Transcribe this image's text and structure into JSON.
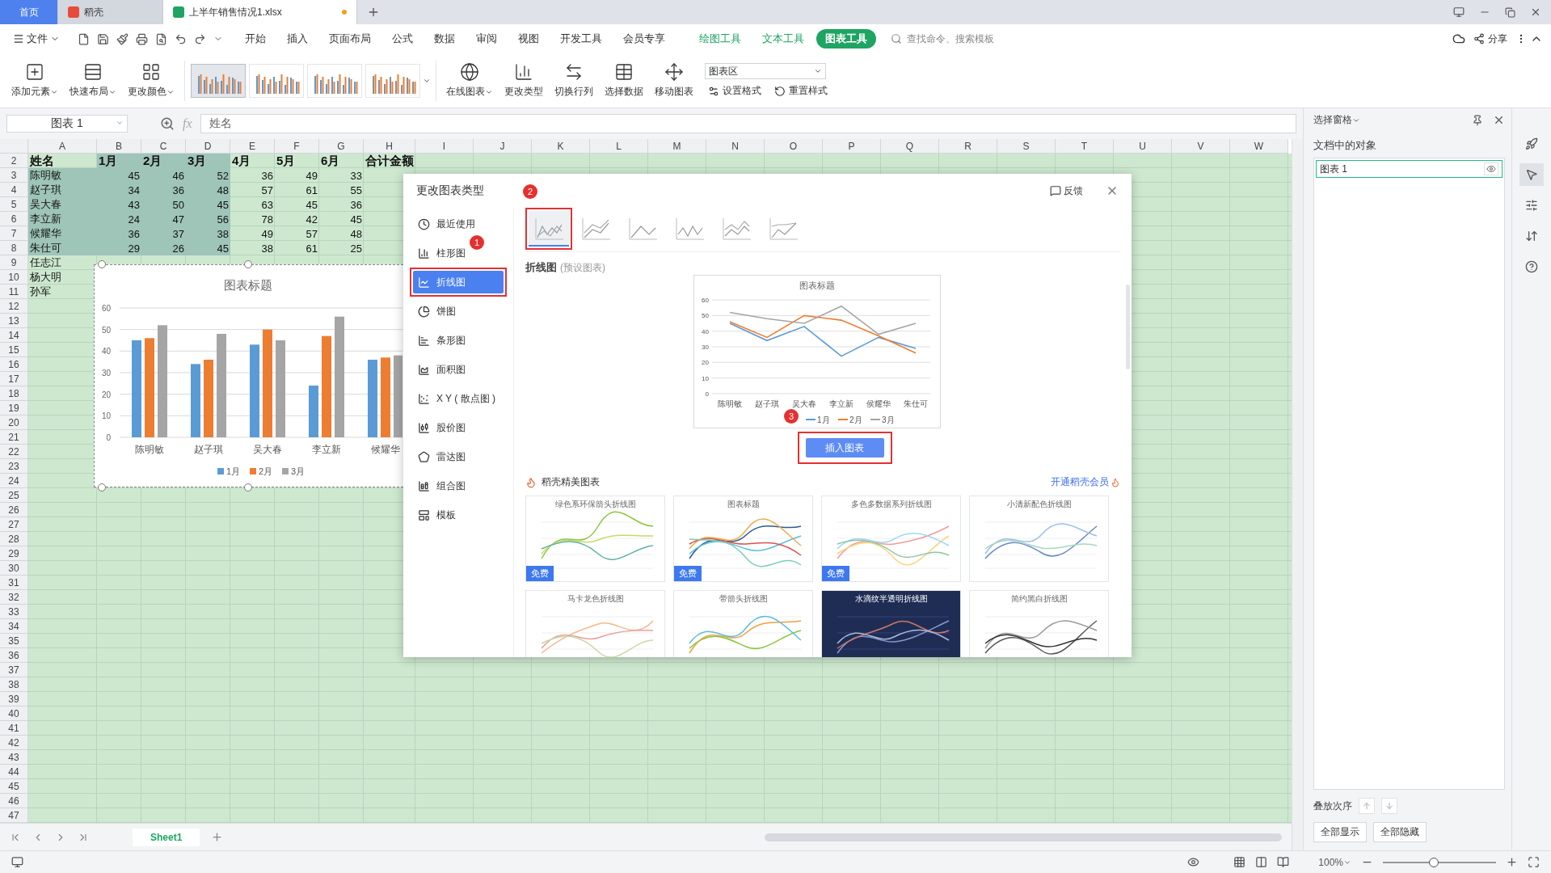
{
  "tabs": [
    {
      "label": "首页",
      "kind": "home",
      "selected": false,
      "modified": false
    },
    {
      "label": "稻壳",
      "kind": "docer",
      "selected": false,
      "modified": false
    },
    {
      "label": "上半年销售情况1.xlsx",
      "kind": "sheet",
      "selected": true,
      "modified": true
    }
  ],
  "menu": {
    "file": "文件",
    "tabs": [
      {
        "label": "开始",
        "kind": "plain",
        "selected": false
      },
      {
        "label": "插入",
        "kind": "plain",
        "selected": false
      },
      {
        "label": "页面布局",
        "kind": "plain",
        "selected": false
      },
      {
        "label": "公式",
        "kind": "plain",
        "selected": false
      },
      {
        "label": "数据",
        "kind": "plain",
        "selected": false
      },
      {
        "label": "审阅",
        "kind": "plain",
        "selected": false
      },
      {
        "label": "视图",
        "kind": "plain",
        "selected": false
      },
      {
        "label": "开发工具",
        "kind": "plain",
        "selected": false
      },
      {
        "label": "会员专享",
        "kind": "plain",
        "selected": false
      },
      {
        "label": "绘图工具",
        "kind": "context",
        "selected": false
      },
      {
        "label": "文本工具",
        "kind": "context",
        "selected": false
      },
      {
        "label": "图表工具",
        "kind": "context",
        "selected": true
      }
    ],
    "search_placeholder": "查找命令、搜索模板",
    "share": "分享"
  },
  "ribbon": {
    "lead": [
      {
        "label": "添加元素",
        "dropdown": true
      },
      {
        "label": "快速布局",
        "dropdown": true
      },
      {
        "label": "更改颜色",
        "dropdown": true
      }
    ],
    "styles": [
      {
        "selected": true
      },
      {
        "selected": false
      },
      {
        "selected": false
      },
      {
        "selected": false
      }
    ],
    "actions": [
      {
        "label": "在线图表",
        "dropdown": true
      },
      {
        "label": "更改类型",
        "dropdown": false
      },
      {
        "label": "切换行列",
        "dropdown": false
      },
      {
        "label": "选择数据",
        "dropdown": false
      },
      {
        "label": "移动图表",
        "dropdown": false
      }
    ],
    "element_select": "图表区",
    "small": [
      "设置格式",
      "重置样式"
    ]
  },
  "formula_bar": {
    "name_box": "图表 1",
    "fx": "fx",
    "value": "姓名"
  },
  "sheet": {
    "columns": [
      "A",
      "B",
      "C",
      "D",
      "E",
      "F",
      "G",
      "H",
      "I",
      "J",
      "K",
      "L",
      "M",
      "N",
      "O",
      "P",
      "Q",
      "R",
      "S",
      "T",
      "U",
      "V",
      "W"
    ],
    "rows": [
      {
        "number": "2",
        "kind": "header",
        "cells": [
          {
            "text": "姓名",
            "selected": false
          },
          {
            "text": "1月",
            "selected": true
          },
          {
            "text": "2月",
            "selected": true
          },
          {
            "text": "3月",
            "selected": true
          },
          {
            "text": "4月",
            "selected": false
          },
          {
            "text": "5月",
            "selected": false
          },
          {
            "text": "6月",
            "selected": false
          },
          {
            "text": "合计金额",
            "selected": false
          }
        ]
      },
      {
        "number": "3",
        "kind": "data",
        "cells": [
          {
            "text": "陈明敏",
            "selected": true
          },
          {
            "text": "45",
            "selected": true
          },
          {
            "text": "46",
            "selected": true
          },
          {
            "text": "52",
            "selected": true
          },
          {
            "text": "36",
            "selected": false
          },
          {
            "text": "49",
            "selected": false
          },
          {
            "text": "33",
            "selected": false
          }
        ]
      },
      {
        "number": "4",
        "kind": "data",
        "cells": [
          {
            "text": "赵子琪",
            "selected": true
          },
          {
            "text": "34",
            "selected": true
          },
          {
            "text": "36",
            "selected": true
          },
          {
            "text": "48",
            "selected": true
          },
          {
            "text": "57",
            "selected": false
          },
          {
            "text": "61",
            "selected": false
          },
          {
            "text": "55",
            "selected": false
          }
        ]
      },
      {
        "number": "5",
        "kind": "data",
        "cells": [
          {
            "text": "吴大春",
            "selected": true
          },
          {
            "text": "43",
            "selected": true
          },
          {
            "text": "50",
            "selected": true
          },
          {
            "text": "45",
            "selected": true
          },
          {
            "text": "63",
            "selected": false
          },
          {
            "text": "45",
            "selected": false
          },
          {
            "text": "36",
            "selected": false
          }
        ]
      },
      {
        "number": "6",
        "kind": "data",
        "cells": [
          {
            "text": "李立新",
            "selected": true
          },
          {
            "text": "24",
            "selected": true
          },
          {
            "text": "47",
            "selected": true
          },
          {
            "text": "56",
            "selected": true
          },
          {
            "text": "78",
            "selected": false
          },
          {
            "text": "42",
            "selected": false
          },
          {
            "text": "45",
            "selected": false
          }
        ]
      },
      {
        "number": "7",
        "kind": "data",
        "cells": [
          {
            "text": "候耀华",
            "selected": true
          },
          {
            "text": "36",
            "selected": true
          },
          {
            "text": "37",
            "selected": true
          },
          {
            "text": "38",
            "selected": true
          },
          {
            "text": "49",
            "selected": false
          },
          {
            "text": "57",
            "selected": false
          },
          {
            "text": "48",
            "selected": false
          }
        ]
      },
      {
        "number": "8",
        "kind": "data",
        "cells": [
          {
            "text": "朱仕可",
            "selected": true
          },
          {
            "text": "29",
            "selected": true
          },
          {
            "text": "26",
            "selected": true
          },
          {
            "text": "45",
            "selected": true
          },
          {
            "text": "38",
            "selected": false
          },
          {
            "text": "61",
            "selected": false
          },
          {
            "text": "25",
            "selected": false
          }
        ]
      },
      {
        "number": "9",
        "kind": "data",
        "cells": [
          {
            "text": "任志江",
            "selected": false
          }
        ]
      },
      {
        "number": "10",
        "kind": "data",
        "cells": [
          {
            "text": "杨大明",
            "selected": false
          }
        ]
      },
      {
        "number": "11",
        "kind": "data",
        "cells": [
          {
            "text": "孙军",
            "selected": false
          }
        ]
      },
      {
        "number": "12"
      },
      {
        "number": "13"
      },
      {
        "number": "14"
      },
      {
        "number": "15"
      },
      {
        "number": "16"
      },
      {
        "number": "17"
      },
      {
        "number": "18"
      },
      {
        "number": "19"
      },
      {
        "number": "20"
      },
      {
        "number": "21"
      },
      {
        "number": "22"
      },
      {
        "number": "23"
      },
      {
        "number": "24"
      },
      {
        "number": "25"
      },
      {
        "number": "26"
      },
      {
        "number": "27"
      },
      {
        "number": "28"
      },
      {
        "number": "29"
      },
      {
        "number": "30"
      },
      {
        "number": "31"
      },
      {
        "number": "32"
      },
      {
        "number": "33"
      },
      {
        "number": "34"
      },
      {
        "number": "35"
      },
      {
        "number": "36"
      },
      {
        "number": "37"
      },
      {
        "number": "38"
      },
      {
        "number": "39"
      },
      {
        "number": "40"
      },
      {
        "number": "41"
      },
      {
        "number": "42"
      },
      {
        "number": "43"
      },
      {
        "number": "44"
      },
      {
        "number": "45"
      },
      {
        "number": "46"
      },
      {
        "number": "47"
      }
    ],
    "chart_data": {
      "type": "bar",
      "title": "图表标题",
      "categories": [
        "陈明敏",
        "赵子琪",
        "吴大春",
        "李立新",
        "候耀华"
      ],
      "series": [
        {
          "name": "1月",
          "color": "#5b9bd5",
          "values": [
            45,
            34,
            43,
            24,
            36
          ]
        },
        {
          "name": "2月",
          "color": "#ed7d31",
          "values": [
            46,
            36,
            50,
            47,
            37
          ]
        },
        {
          "name": "3月",
          "color": "#a5a5a5",
          "values": [
            52,
            48,
            45,
            56,
            38
          ]
        }
      ],
      "ylim": [
        0,
        60
      ],
      "yticks": [
        0,
        10,
        20,
        30,
        40,
        50,
        60
      ],
      "grid": true,
      "legend": "bottom"
    },
    "sheet_tabs": [
      {
        "label": "Sheet1",
        "selected": true
      }
    ]
  },
  "dialog": {
    "title": "更改图表类型",
    "feedback": "反馈",
    "categories": [
      {
        "label": "最近使用",
        "selected": false,
        "framed": false
      },
      {
        "label": "柱形图",
        "selected": false,
        "framed": false
      },
      {
        "label": "折线图",
        "selected": true,
        "framed": true
      },
      {
        "label": "饼图",
        "selected": false,
        "framed": false
      },
      {
        "label": "条形图",
        "selected": false,
        "framed": false
      },
      {
        "label": "面积图",
        "selected": false,
        "framed": false
      },
      {
        "label": "X Y ( 散点图 )",
        "selected": false,
        "framed": false
      },
      {
        "label": "股价图",
        "selected": false,
        "framed": false
      },
      {
        "label": "雷达图",
        "selected": false,
        "framed": false
      },
      {
        "label": "组合图",
        "selected": false,
        "framed": false
      },
      {
        "label": "模板",
        "selected": false,
        "framed": false
      }
    ],
    "subtypes": [
      {
        "selected": true,
        "framed": true
      },
      {
        "selected": false,
        "framed": false
      },
      {
        "selected": false,
        "framed": false
      },
      {
        "selected": false,
        "framed": false
      },
      {
        "selected": false,
        "framed": false
      },
      {
        "selected": false,
        "framed": false
      }
    ],
    "preview_title": "折线图",
    "preview_note": "(预设图表)",
    "chart_data": {
      "type": "line",
      "title": "图表标题",
      "categories": [
        "陈明敏",
        "赵子琪",
        "吴大春",
        "李立新",
        "侯耀华",
        "朱仕可"
      ],
      "series": [
        {
          "name": "1月",
          "color": "#5b9bd5",
          "values": [
            45,
            34,
            43,
            24,
            36,
            29
          ]
        },
        {
          "name": "2月",
          "color": "#ed7d31",
          "values": [
            46,
            36,
            50,
            47,
            37,
            26
          ]
        },
        {
          "name": "3月",
          "color": "#a5a5a5",
          "values": [
            52,
            48,
            45,
            56,
            38,
            45
          ]
        }
      ],
      "ylim": [
        0,
        60
      ],
      "yticks": [
        0,
        10,
        20,
        30,
        40,
        50,
        60
      ],
      "grid": true,
      "legend": "bottom"
    },
    "insert_button": {
      "label": "插入图表",
      "framed": true
    },
    "annotations": [
      {
        "label": "1"
      },
      {
        "label": "2"
      },
      {
        "label": "3"
      }
    ],
    "gallery_title": "稻壳精美图表",
    "member_link": "开通稻壳会员",
    "templates": [
      {
        "title": "绿色系环保箭头折线图",
        "kind": "light",
        "badge": "免费"
      },
      {
        "title": "图表标题",
        "kind": "light",
        "badge": "免费"
      },
      {
        "title": "多色多数据系列折线图",
        "kind": "light",
        "badge": "免费"
      },
      {
        "title": "小清新配色折线图",
        "kind": "light"
      },
      {
        "title": "马卡龙色折线图",
        "kind": "light"
      },
      {
        "title": "带箭头折线图",
        "kind": "light"
      },
      {
        "title": "水滴纹半透明折线图",
        "kind": "dark"
      },
      {
        "title": "简约黑白折线图",
        "kind": "light"
      }
    ]
  },
  "selection_pane": {
    "title": "选择窗格",
    "heading": "文档中的对象",
    "objects": [
      {
        "label": "图表 1",
        "selected": true
      }
    ],
    "order_label": "叠放次序",
    "buttons": [
      "全部显示",
      "全部隐藏"
    ]
  },
  "side_tools": [
    {
      "selected": false
    },
    {
      "selected": true
    },
    {
      "selected": false
    },
    {
      "selected": false
    },
    {
      "selected": false
    }
  ],
  "status_bar": {
    "zoom": "100%",
    "slider": {
      "level": 0.45
    }
  }
}
